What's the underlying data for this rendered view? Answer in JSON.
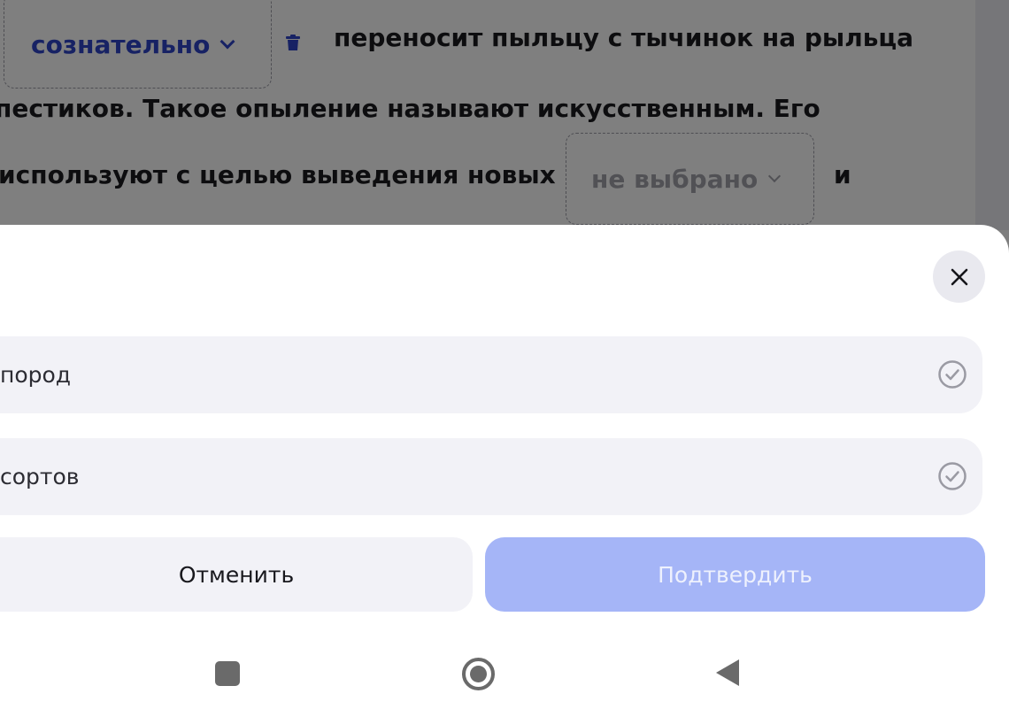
{
  "exercise": {
    "selected_word": "сознательно",
    "line1_text": "переносит пыльцу с тычинок на рыльца",
    "line2_text": "пестиков. Такое опыление называют искусственным. Его",
    "line3_text": "используют с целью выведения новых",
    "empty_dropdown": "не выбрано",
    "line3_tail": "и"
  },
  "sheet": {
    "options": [
      {
        "label": "пород",
        "state": "unselected"
      },
      {
        "label": "сортов",
        "state": "unselected"
      }
    ],
    "cancel_label": "Отменить",
    "confirm_label": "Подтвердить"
  },
  "colors": {
    "accent": "#2f44c8",
    "confirm_disabled": "#a5b5f7",
    "option_bg": "#f2f2f7"
  },
  "icons": {
    "close": "close-icon",
    "option_check": "check-circle-icon",
    "delete": "trash-icon"
  }
}
